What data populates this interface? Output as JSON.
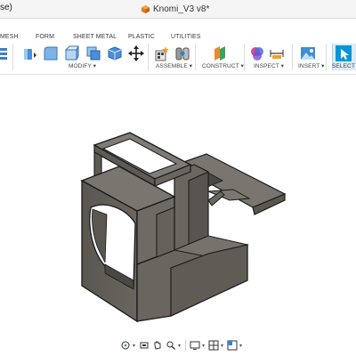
{
  "window": {
    "title_fragment": "se)",
    "document_title": "Knomi_V3 v8*",
    "accent": "#0696d7"
  },
  "ribbon": {
    "tabs": [
      "MESH",
      "FORM",
      "SHEET METAL",
      "PLASTIC",
      "UTILITIES"
    ],
    "groups": {
      "modify": "MODIFY ▾",
      "assemble": "ASSEMBLE ▾",
      "construct": "CONSTRUCT ▾",
      "inspect": "INSPECT ▾",
      "insert": "INSERT ▾",
      "select": "SELECT ▾"
    },
    "icons": [
      "mesh-icon",
      "press-pull-icon",
      "fillet-icon",
      "shell-icon",
      "combine-icon",
      "move-icon",
      "new-component-icon",
      "joint-icon",
      "offset-plane-icon",
      "interference-icon",
      "measure-icon",
      "insert-image-icon",
      "select-icon"
    ]
  },
  "viewport": {
    "model_color": "#6e6a64"
  },
  "navbar": {
    "icons": [
      "orbit-icon",
      "pan-icon",
      "hand-icon",
      "zoom-icon",
      "display-settings-icon",
      "grid-icon",
      "viewports-icon"
    ]
  }
}
